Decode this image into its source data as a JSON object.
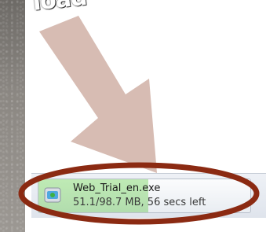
{
  "banner": {
    "text": "load"
  },
  "download": {
    "file_name": "Web_Trial_en.exe",
    "status": "51.1/98.7 MB, 56 secs left",
    "progress_fraction": 0.518
  },
  "colors": {
    "arrow": "#d7bcb3",
    "ring": "#8b2a12",
    "progress": "#7cd064"
  }
}
